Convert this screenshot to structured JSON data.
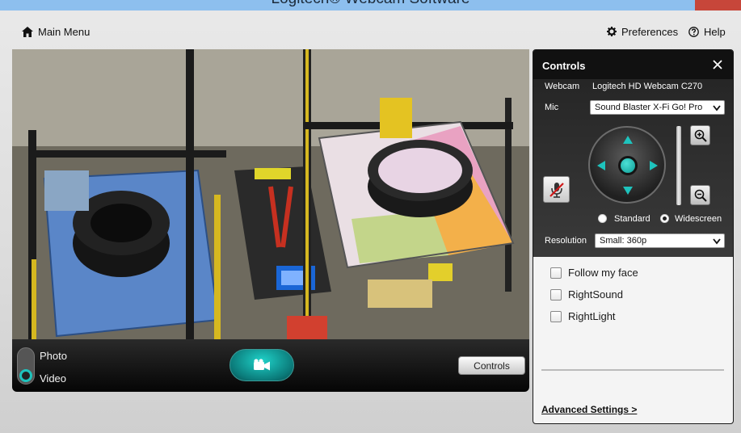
{
  "window": {
    "title": "Logitech® Webcam Software"
  },
  "header": {
    "main_menu": "Main Menu",
    "preferences": "Preferences",
    "help": "Help"
  },
  "capture_mode": {
    "photo_label": "Photo",
    "video_label": "Video",
    "selected": "Video"
  },
  "controls_button_label": "Controls",
  "panel": {
    "title": "Controls",
    "webcam_label": "Webcam",
    "webcam_value": "Logitech HD Webcam C270",
    "mic_label": "Mic",
    "mic_value": "Sound Blaster X-Fi Go! Pro",
    "aspect": {
      "standard": "Standard",
      "widescreen": "Widescreen",
      "selected": "Widescreen"
    },
    "resolution_label": "Resolution",
    "resolution_value": "Small: 360p",
    "options": [
      {
        "label": "Follow my face",
        "checked": false
      },
      {
        "label": "RightSound",
        "checked": false
      },
      {
        "label": "RightLight",
        "checked": false
      }
    ],
    "advanced_link": "Advanced Settings >"
  },
  "colors": {
    "accent": "#1ec3bd",
    "panel_dark": "#111111",
    "titlebar": "#8dbfee"
  },
  "icons": [
    "home-icon",
    "gear-icon",
    "help-icon",
    "video-camera-icon",
    "close-icon",
    "mic-mute-icon",
    "zoom-in-icon",
    "zoom-out-icon"
  ]
}
